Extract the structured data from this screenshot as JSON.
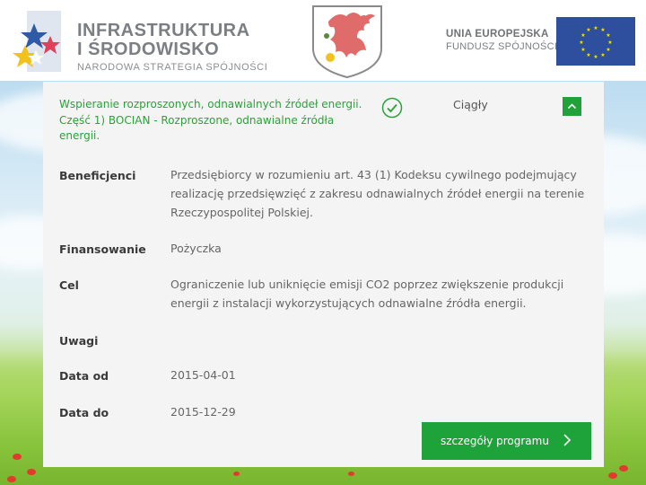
{
  "header": {
    "logo_line1": "INFRASTRUKTURA",
    "logo_line2": "I ŚRODOWISKO",
    "logo_line3": "NARODOWA STRATEGIA SPÓJNOŚCI",
    "eu_line1": "UNIA EUROPEJSKA",
    "eu_line2": "FUNDUSZ SPÓJNOŚCI",
    "icons": [
      "innovative-economy-stars-icon",
      "griffin-crest-icon",
      "eu-flag-icon"
    ],
    "colors": {
      "eu_blue": "#2e4f9e",
      "eu_star": "#ffdd00",
      "crest_red": "#e06b6b"
    }
  },
  "program": {
    "title_line1": "Wspieranie rozproszonych, odnawialnych źródeł energii.",
    "title_line2": "Część 1) BOCIAN - Rozproszone, odnawialne źródła energii.",
    "status": "Ciągły",
    "status_icon": "check-circle-icon",
    "collapse_icon": "chevron-up-icon",
    "rows": [
      {
        "label": "Beneficjenci",
        "value": "Przedsiębiorcy w rozumieniu art. 43 (1) Kodeksu cywilnego podejmujący realizację przedsięwzięć z zakresu odnawialnych źródeł energii na terenie Rzeczypospolitej Polskiej."
      },
      {
        "label": "Finansowanie",
        "value": "Pożyczka"
      },
      {
        "label": "Cel",
        "value": "Ograniczenie lub uniknięcie emisji CO2 poprzez zwiększenie produkcji energii z instalacji wykorzystujących odnawialne źródła energii."
      },
      {
        "label": "Uwagi",
        "value": ""
      },
      {
        "label": "Data od",
        "value": "2015-04-01"
      },
      {
        "label": "Data do",
        "value": "2015-12-29"
      }
    ],
    "details_button": "szczegóły programu",
    "details_icon": "chevron-right-icon",
    "colors": {
      "accent_green": "#1ea33b",
      "title_green": "#2aa23a"
    }
  }
}
